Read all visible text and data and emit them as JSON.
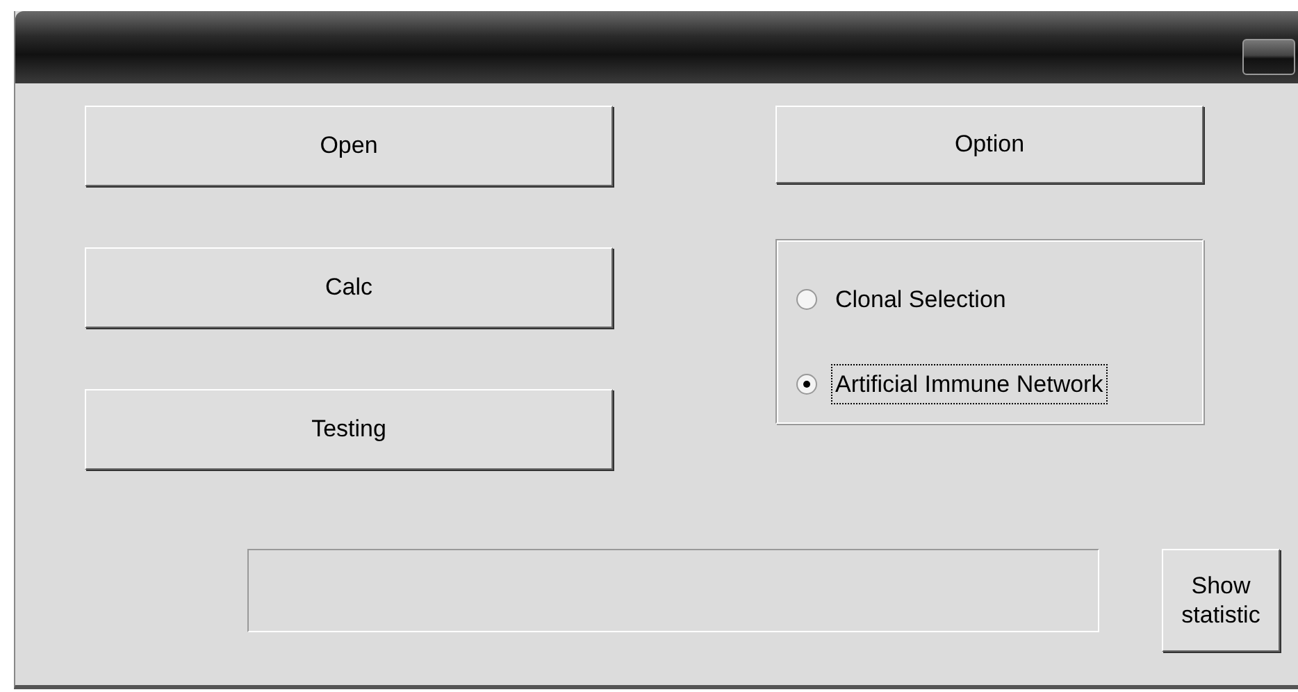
{
  "left_buttons": [
    {
      "label": "Open"
    },
    {
      "label": "Calc"
    },
    {
      "label": "Testing"
    }
  ],
  "option_button": {
    "label": "Option"
  },
  "algorithm": [
    {
      "label": "Clonal Selection",
      "selected": false
    },
    {
      "label": "Artificial Immune Network",
      "selected": true
    }
  ],
  "statistic_button": {
    "label": "Show\nstatistic"
  }
}
